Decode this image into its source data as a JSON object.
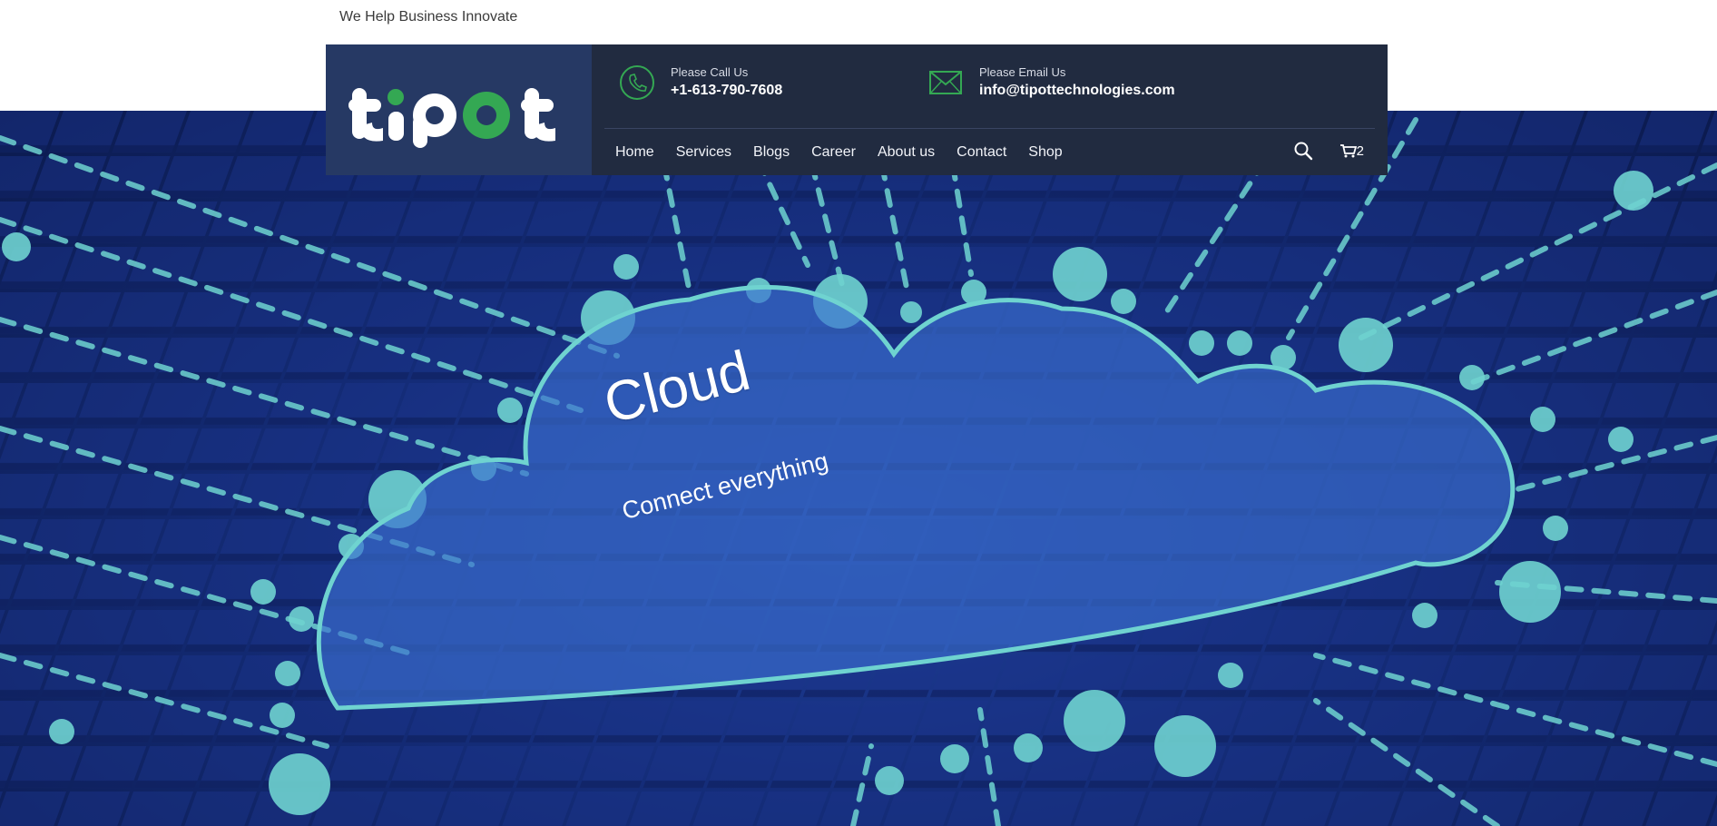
{
  "top_bar": {
    "tagline": "We Help Business Innovate"
  },
  "brand": {
    "logo_text": "tipot",
    "colors": {
      "white": "#ffffff",
      "green": "#34a853"
    }
  },
  "contact": {
    "phone": {
      "label": "Please Call Us",
      "value": "+1-613-790-7608",
      "icon": "phone-icon"
    },
    "email": {
      "label": "Please Email Us",
      "value": "info@tipottechnologies.com",
      "icon": "mail-icon"
    }
  },
  "nav": {
    "items": [
      {
        "label": "Home"
      },
      {
        "label": "Services"
      },
      {
        "label": "Blogs"
      },
      {
        "label": "Career"
      },
      {
        "label": "About us"
      },
      {
        "label": "Contact"
      },
      {
        "label": "Shop"
      }
    ]
  },
  "tools": {
    "search_icon": "search-icon",
    "cart_icon": "cart-icon",
    "cart_count": "2"
  },
  "hero": {
    "title": "Cloud",
    "subtitle": "Connect everything"
  },
  "theme": {
    "header_bg": "#212b40",
    "logo_bg": "#263964",
    "accent": "#34a853",
    "hero_blue": "#1f3f9a",
    "cyan": "#6fd3d0"
  }
}
